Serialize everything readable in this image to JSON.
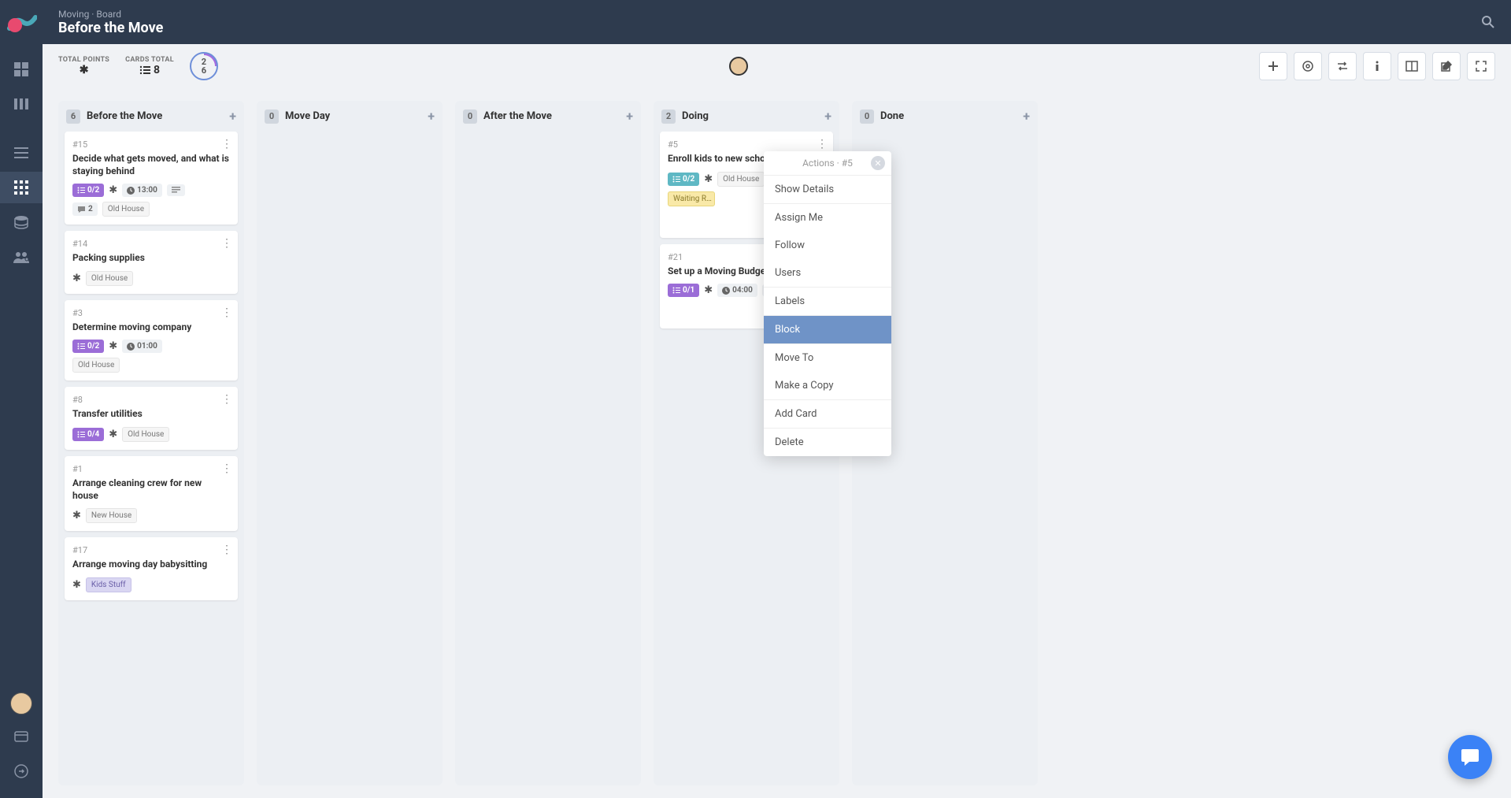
{
  "breadcrumb": "Moving · Board",
  "page_title": "Before the Move",
  "stats": {
    "points_label": "TOTAL POINTS",
    "cards_label": "CARDS TOTAL",
    "cards_value": "8",
    "circle_top": "2",
    "circle_bottom": "6"
  },
  "columns": [
    {
      "count": "6",
      "title": "Before the Move",
      "cards": [
        {
          "id": "#15",
          "title": "Decide what gets moved, and what is staying behind",
          "progress": "0/2",
          "progress_color": "purple",
          "star": true,
          "time": "13:00",
          "desc_icon": true,
          "comments": "2",
          "tags": [
            "Old House"
          ]
        },
        {
          "id": "#14",
          "title": "Packing supplies",
          "star": true,
          "tags": [
            "Old House"
          ]
        },
        {
          "id": "#3",
          "title": "Determine moving company",
          "progress": "0/2",
          "progress_color": "purple",
          "star": true,
          "time": "01:00",
          "tags": [
            "Old House"
          ]
        },
        {
          "id": "#8",
          "title": "Transfer utilities",
          "progress": "0/4",
          "progress_color": "purple",
          "star": true,
          "tags": [
            "Old House"
          ]
        },
        {
          "id": "#1",
          "title": "Arrange cleaning crew for new house",
          "star": true,
          "tags": [
            "New House"
          ]
        },
        {
          "id": "#17",
          "title": "Arrange moving day babysitting",
          "star": true,
          "tags_lav": [
            "Kids Stuff"
          ]
        }
      ]
    },
    {
      "count": "0",
      "title": "Move Day",
      "cards": []
    },
    {
      "count": "0",
      "title": "After the Move",
      "cards": []
    },
    {
      "count": "2",
      "title": "Doing",
      "cards": [
        {
          "id": "#5",
          "title": "Enroll kids to new school",
          "progress": "0/2",
          "progress_color": "teal",
          "star": true,
          "tags": [
            "Old House"
          ],
          "tags_yellow": [
            "Waiting R…"
          ],
          "avatar": true,
          "users_icon": true
        },
        {
          "id": "#21",
          "title": "Set up a Moving Budget",
          "progress": "0/1",
          "progress_color": "purple",
          "star": true,
          "time": "04:00",
          "desc_icon": true,
          "avatar": true,
          "users_icon": true
        }
      ]
    },
    {
      "count": "0",
      "title": "Done",
      "cards": []
    }
  ],
  "popup": {
    "title": "Actions · #5",
    "groups": [
      [
        "Show Details"
      ],
      [
        "Assign Me",
        "Follow",
        "Users"
      ],
      [
        "Labels"
      ],
      [
        "Block"
      ],
      [
        "Move To",
        "Make a Copy"
      ],
      [
        "Add Card"
      ],
      [
        "Delete"
      ]
    ],
    "highlighted": "Block"
  }
}
